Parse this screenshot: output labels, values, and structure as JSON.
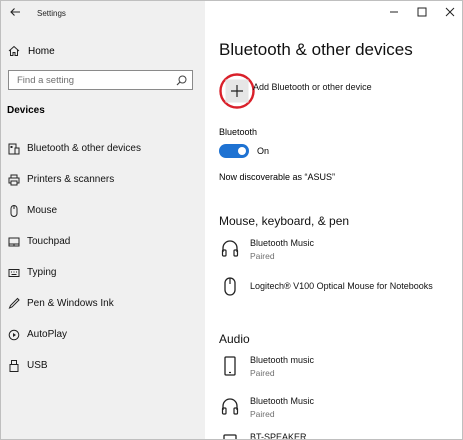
{
  "window": {
    "app_title": "Settings"
  },
  "sidebar": {
    "home_label": "Home",
    "search_placeholder": "Find a setting",
    "section_heading": "Devices",
    "items": [
      {
        "label": "Bluetooth & other devices",
        "icon": "bluetooth-devices-icon"
      },
      {
        "label": "Printers & scanners",
        "icon": "printer-icon"
      },
      {
        "label": "Mouse",
        "icon": "mouse-icon"
      },
      {
        "label": "Touchpad",
        "icon": "touchpad-icon"
      },
      {
        "label": "Typing",
        "icon": "keyboard-icon"
      },
      {
        "label": "Pen & Windows Ink",
        "icon": "pen-icon"
      },
      {
        "label": "AutoPlay",
        "icon": "autoplay-icon"
      },
      {
        "label": "USB",
        "icon": "usb-icon"
      }
    ]
  },
  "main": {
    "title": "Bluetooth & other devices",
    "add_device_label": "Add Bluetooth or other device",
    "bluetooth_label": "Bluetooth",
    "bluetooth_state": "On",
    "bluetooth_on": true,
    "discoverable_text": "Now discoverable as “ASUS”",
    "sections": [
      {
        "title": "Mouse, keyboard, & pen",
        "devices": [
          {
            "name": "Bluetooth Music",
            "status": "Paired",
            "icon": "headphones-icon"
          },
          {
            "name": "Logitech® V100 Optical Mouse for Notebooks",
            "status": "",
            "icon": "mouse-icon"
          }
        ]
      },
      {
        "title": "Audio",
        "devices": [
          {
            "name": "Bluetooth music",
            "status": "Paired",
            "icon": "phone-icon"
          },
          {
            "name": "Bluetooth Music",
            "status": "Paired",
            "icon": "headphones-icon"
          },
          {
            "name": "BT-SPEAKER",
            "status": "",
            "icon": "speaker-icon"
          }
        ]
      }
    ]
  },
  "colors": {
    "accent": "#1e72d2",
    "sidebar_bg": "#f0f0f0",
    "highlight_ring": "#d9202a"
  }
}
